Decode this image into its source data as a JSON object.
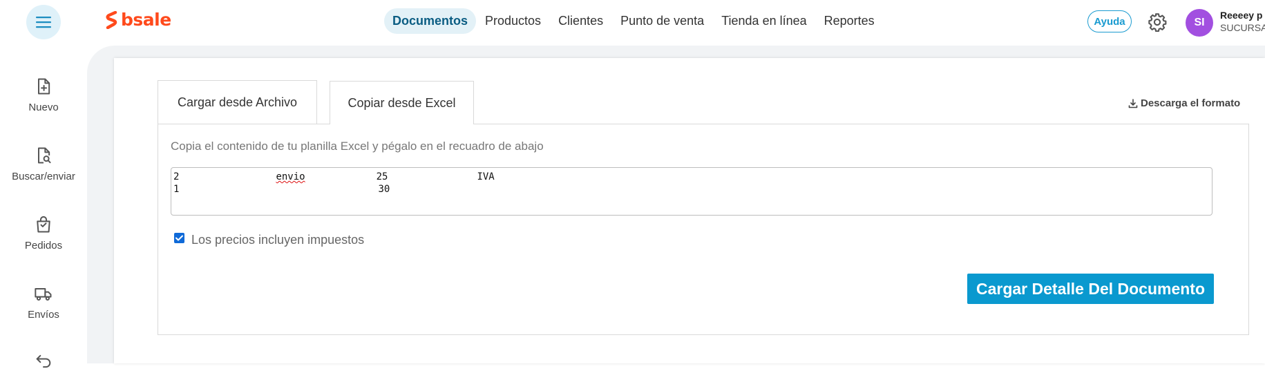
{
  "header": {
    "logo_text": "bsale",
    "nav": [
      {
        "label": "Documentos",
        "active": true
      },
      {
        "label": "Productos"
      },
      {
        "label": "Clientes"
      },
      {
        "label": "Punto de venta"
      },
      {
        "label": "Tienda en línea"
      },
      {
        "label": "Reportes"
      }
    ],
    "help_label": "Ayuda",
    "avatar_initials": "SI",
    "user_name": "Reeeey p",
    "user_branch": "SUCURSA"
  },
  "sidebar": {
    "items": [
      {
        "label": "Nuevo",
        "icon": "file-plus-icon"
      },
      {
        "label": "Buscar/enviar",
        "icon": "file-search-icon"
      },
      {
        "label": "Pedidos",
        "icon": "shopping-bag-icon"
      },
      {
        "label": "Envíos",
        "icon": "truck-icon"
      },
      {
        "label": "",
        "icon": "return-icon"
      }
    ]
  },
  "tabs": [
    {
      "label": "Cargar desde Archivo"
    },
    {
      "label": "Copiar desde Excel",
      "active": true
    }
  ],
  "download_label": "Descarga el formato",
  "instructions": "Copia el contenido de tu planilla Excel y pégalo en el recuadro de abajo",
  "textarea": {
    "rows": [
      [
        "2",
        "envio",
        "25",
        "IVA"
      ],
      [
        "1",
        "",
        "30",
        ""
      ]
    ]
  },
  "checkbox": {
    "label": "Los precios incluyen impuestos",
    "checked": true
  },
  "submit_label": "Cargar Detalle Del Documento",
  "colors": {
    "accent": "#0a99cf",
    "brand": "#ff4a1c",
    "avatar": "#a24fe0"
  }
}
